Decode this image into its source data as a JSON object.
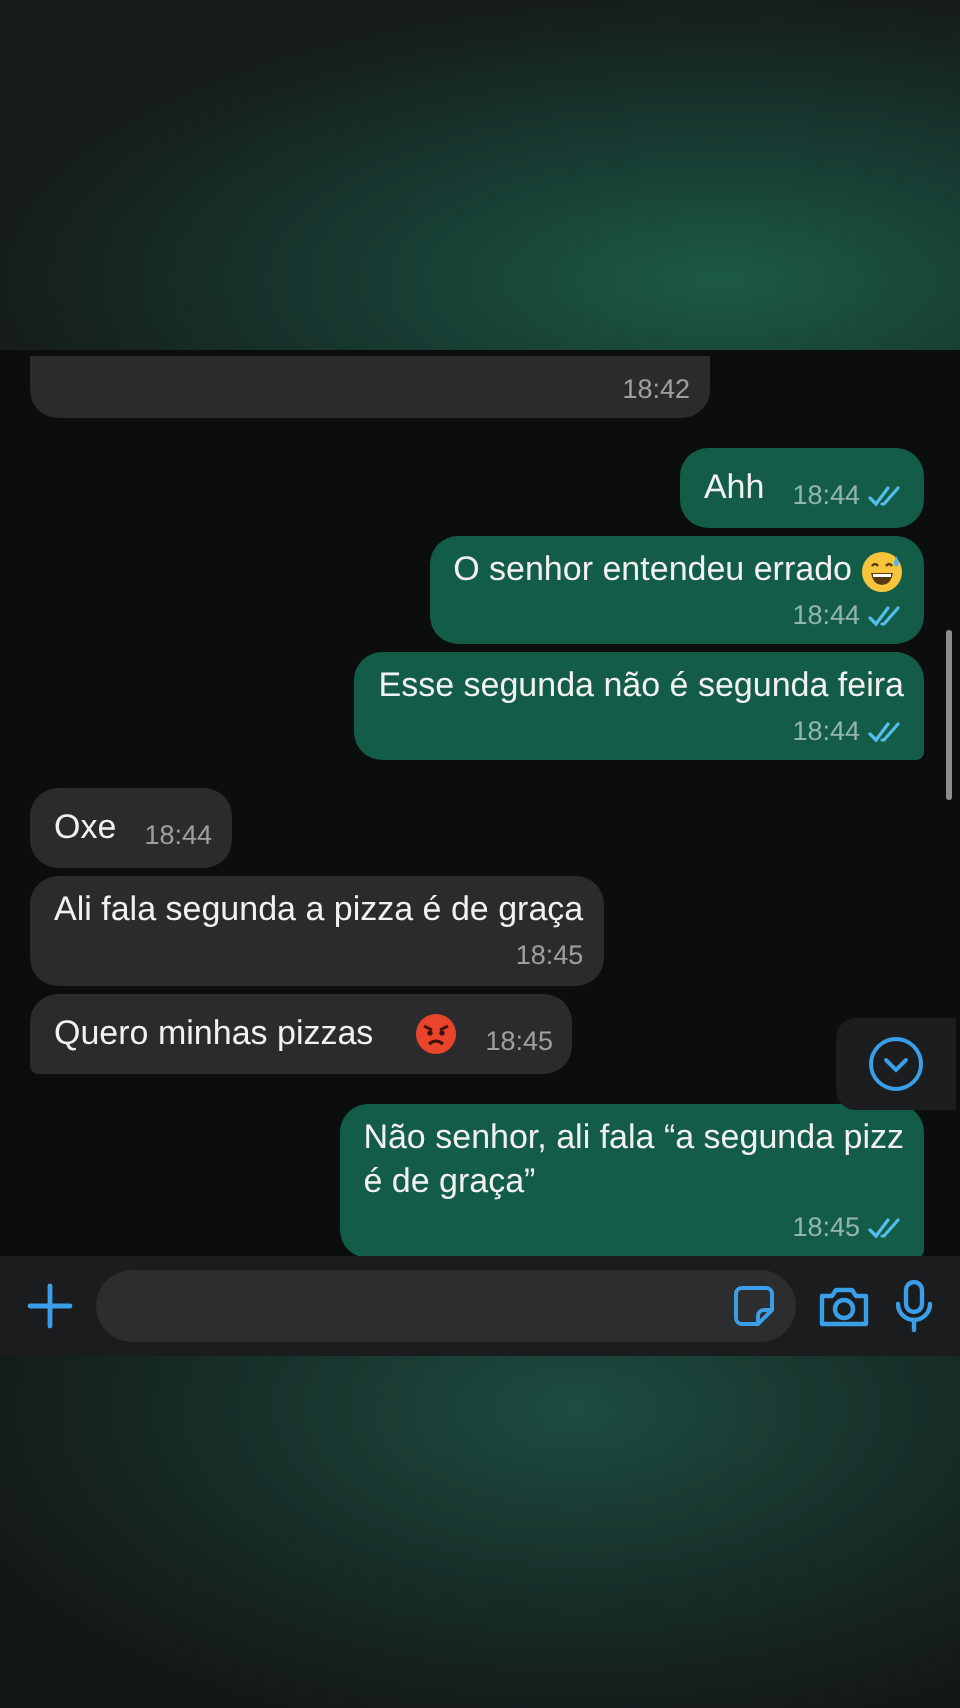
{
  "messages": [
    {
      "kind": "received",
      "time": "18:42",
      "time_inline": false,
      "clipped": true
    },
    {
      "kind": "sent",
      "lines": [
        "Ahh"
      ],
      "time": "18:44",
      "time_inline": true,
      "read": true
    },
    {
      "kind": "sent",
      "lines": [
        "O senhor entendeu errado"
      ],
      "emoji": {
        "kind": "sweat-smile"
      },
      "time": "18:44",
      "time_inline": false,
      "read": true
    },
    {
      "kind": "sent",
      "lines": [
        "Esse segunda não é segunda feira"
      ],
      "time": "18:44",
      "time_inline": false,
      "read": true,
      "tail": true
    },
    {
      "kind": "received",
      "lines": [
        "Oxe"
      ],
      "time": "18:44",
      "time_inline": true
    },
    {
      "kind": "received",
      "lines": [
        "Ali fala segunda a pizza é de graça"
      ],
      "time": "18:45",
      "time_inline": false
    },
    {
      "kind": "received",
      "lines": [
        "Quero minhas pizzas"
      ],
      "emoji": {
        "kind": "angry"
      },
      "time": "18:45",
      "time_inline": true,
      "tail": true
    },
    {
      "kind": "sent",
      "lines": [
        "Não senhor, ali fala “a segunda pizz",
        "é de graça”"
      ],
      "time": "18:45",
      "time_inline": false,
      "read": true,
      "tail": true
    }
  ]
}
